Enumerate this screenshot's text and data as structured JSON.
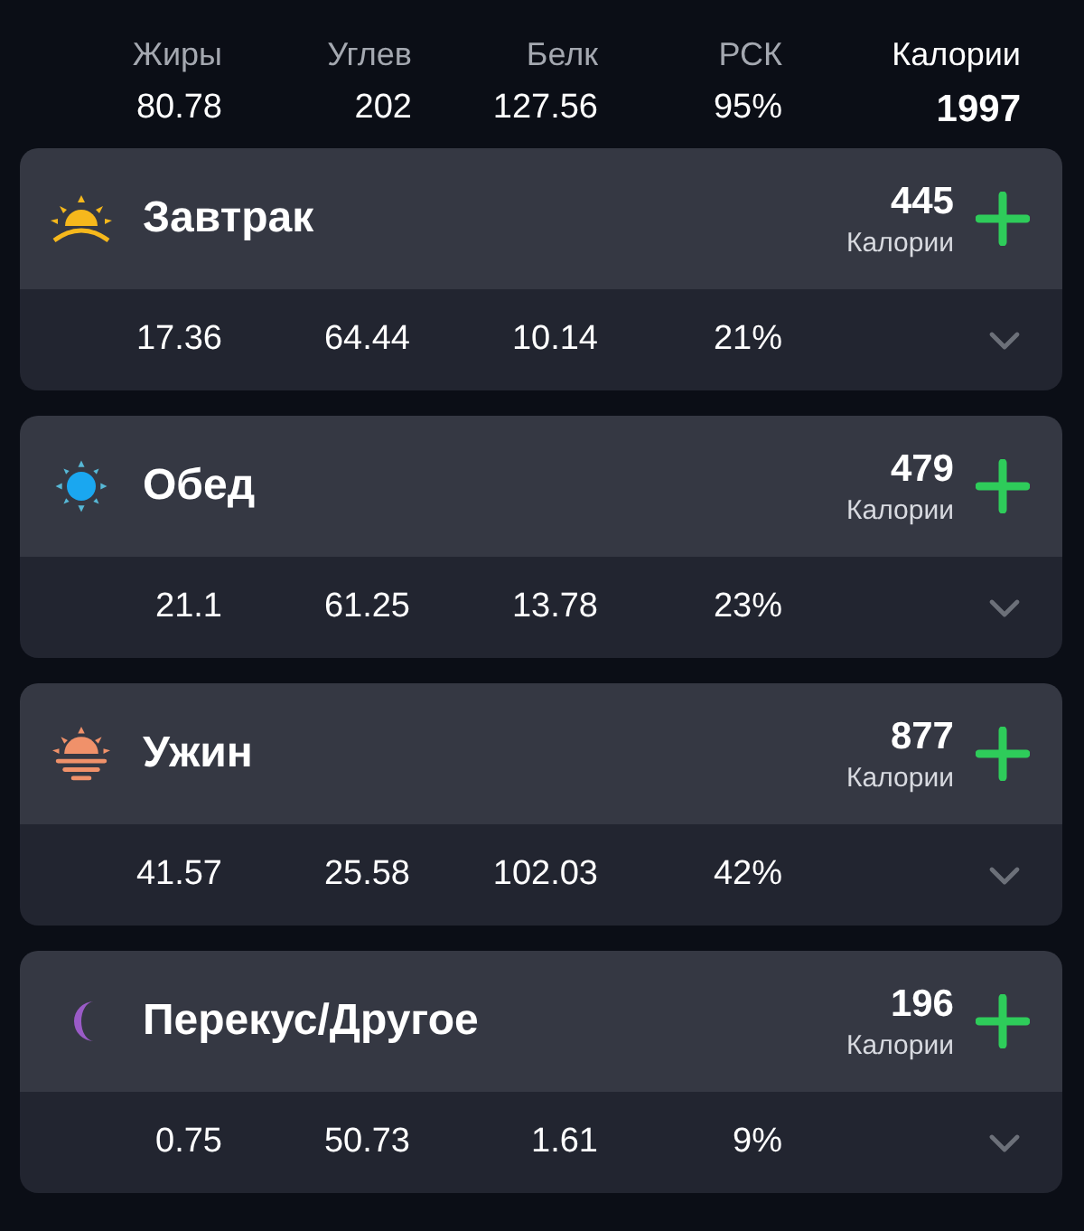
{
  "summary": {
    "columns": [
      {
        "label": "Жиры",
        "value": "80.78",
        "kind": "macro"
      },
      {
        "label": "Углев",
        "value": "202",
        "kind": "macro"
      },
      {
        "label": "Белк",
        "value": "127.56",
        "kind": "macro"
      },
      {
        "label": "РСК",
        "value": "95%",
        "kind": "macro"
      },
      {
        "label": "Калории",
        "value": "1997",
        "kind": "total"
      }
    ]
  },
  "meals": [
    {
      "name": "Завтрак",
      "calories": "445",
      "calories_label": "Калории",
      "values": [
        "17.36",
        "64.44",
        "10.14",
        "21%"
      ],
      "expanded": false
    },
    {
      "name": "Обед",
      "calories": "479",
      "calories_label": "Калории",
      "values": [
        "21.1",
        "61.25",
        "13.78",
        "23%"
      ],
      "expanded": false
    },
    {
      "name": "Ужин",
      "calories": "877",
      "calories_label": "Калории",
      "values": [
        "41.57",
        "25.58",
        "102.03",
        "42%"
      ],
      "expanded": false
    },
    {
      "name": "Перекус/Другое",
      "calories": "196",
      "calories_label": "Калории",
      "values": [
        "0.75",
        "50.73",
        "1.61",
        "9%"
      ],
      "expanded": false
    }
  ]
}
